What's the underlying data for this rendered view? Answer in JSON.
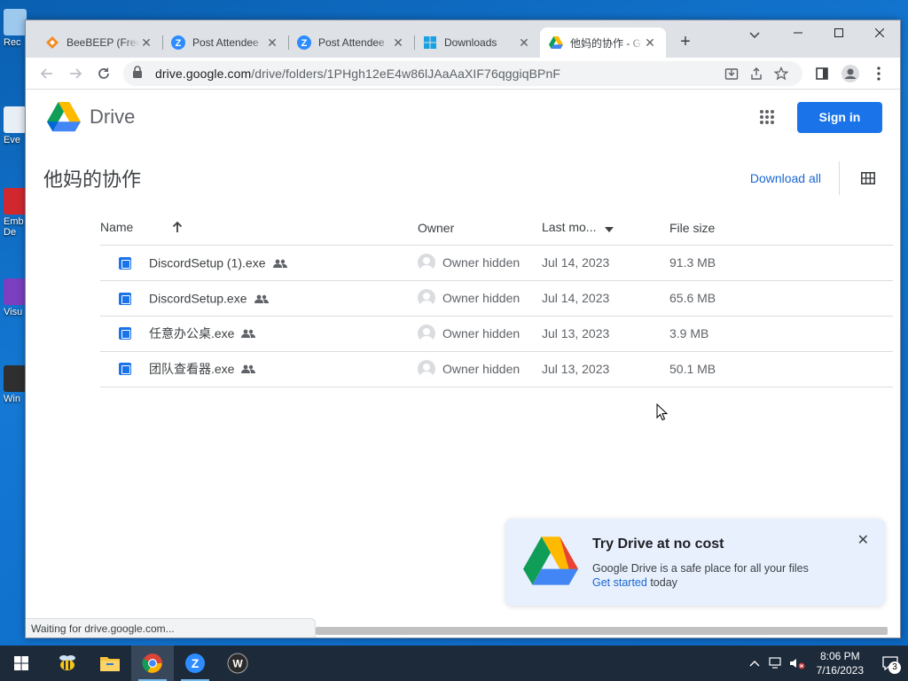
{
  "desktop": {
    "icons": [
      {
        "label": "Rec"
      },
      {
        "label": "Eve"
      },
      {
        "label": "Emb"
      },
      {
        "label": "De"
      },
      {
        "label": "Visu"
      },
      {
        "label": "Win"
      }
    ]
  },
  "browser": {
    "tabs": [
      {
        "title": "BeeBEEP (Free",
        "icon": "beebeep-icon",
        "active": false
      },
      {
        "title": "Post Attendee",
        "icon": "zoom-icon",
        "active": false
      },
      {
        "title": "Post Attendee",
        "icon": "zoom-icon",
        "active": false
      },
      {
        "title": "Downloads",
        "icon": "windows-icon",
        "active": false
      },
      {
        "title": "他妈的协作 - G",
        "icon": "google-drive-icon",
        "active": true
      }
    ],
    "new_tab": "+",
    "address": {
      "host": "drive.google.com",
      "path": "/drive/folders/1PHgh12eE4w86lJAaAaXIF76qggiqBPnF"
    },
    "status_text": "Waiting for drive.google.com..."
  },
  "drive": {
    "brand": "Drive",
    "sign_in": "Sign in",
    "folder_title": "他妈的协作",
    "download_all": "Download all",
    "columns": {
      "name": "Name",
      "owner": "Owner",
      "modified": "Last mo...",
      "size": "File size"
    },
    "files": [
      {
        "name": "DiscordSetup (1).exe",
        "owner": "Owner hidden",
        "modified": "Jul 14, 2023",
        "size": "91.3 MB"
      },
      {
        "name": "DiscordSetup.exe",
        "owner": "Owner hidden",
        "modified": "Jul 14, 2023",
        "size": "65.6 MB"
      },
      {
        "name": "任意办公桌.exe",
        "owner": "Owner hidden",
        "modified": "Jul 13, 2023",
        "size": "3.9 MB"
      },
      {
        "name": "团队查看器.exe",
        "owner": "Owner hidden",
        "modified": "Jul 13, 2023",
        "size": "50.1 MB"
      }
    ],
    "promo": {
      "title": "Try Drive at no cost",
      "line1": "Google Drive is a safe place for all your files",
      "link": "Get started",
      "link_suffix": " today"
    }
  },
  "taskbar": {
    "time": "8:06 PM",
    "date": "7/16/2023",
    "notifications": "3"
  },
  "colors": {
    "accent": "#1a73e8",
    "link": "#1967d2",
    "taskbar": "#1c2a3a"
  }
}
